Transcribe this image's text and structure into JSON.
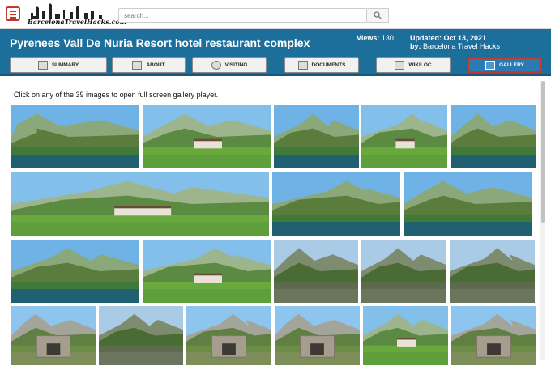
{
  "topbar": {
    "logo_text": "BarcelonaTravelHacks.com",
    "search_placeholder": "search...",
    "icons": [
      "menu-icon",
      "search-icon"
    ]
  },
  "header": {
    "title": "Pyrenees Vall De Nuria Resort hotel restaurant complex",
    "views_label": "Views:",
    "views_value": "130",
    "updated_label": "Updated:",
    "updated_value": "Oct 13, 2021",
    "by_label": "by:",
    "by_value": "Barcelona Travel Hacks"
  },
  "tabs": [
    {
      "label": "SUMMARY",
      "icon": "summary-icon",
      "active": false
    },
    {
      "label": "ABOUT",
      "icon": "about-icon",
      "active": false
    },
    {
      "label": "VISITING",
      "icon": "clock-icon",
      "active": false
    },
    {
      "label": "DOCUMENTS",
      "icon": "documents-icon",
      "active": false
    },
    {
      "label": "WIKILOC",
      "icon": "map-icon",
      "active": false
    },
    {
      "label": "GALLERY",
      "icon": "gallery-icon",
      "active": true
    }
  ],
  "gallery": {
    "hint": "Click on any of the 39 images to open full screen gallery player.",
    "image_count": 39
  },
  "colors": {
    "header_bg": "#1d6f9b",
    "active_tab_bg": "#2b7ab3",
    "active_tab_border": "#c0392b",
    "menu_icon": "#c0392b"
  }
}
